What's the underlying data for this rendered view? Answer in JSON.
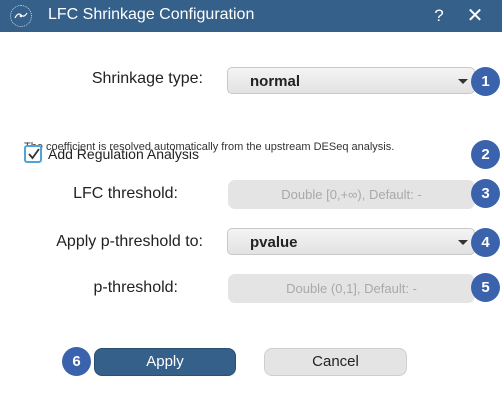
{
  "window": {
    "title": "LFC Shrinkage Configuration",
    "help_label": "?",
    "close_label": "✕",
    "app_icon": "app-logo-icon",
    "accent_color": "#34608a"
  },
  "form": {
    "shrinkage_type": {
      "label": "Shrinkage type:",
      "value": "normal"
    },
    "note": "The coefficient is resolved automatically from the upstream DESeq analysis.",
    "regulation": {
      "label": "Add Regulation Analysis",
      "checked": true
    },
    "lfc_threshold": {
      "label": "LFC threshold:",
      "placeholder": "Double [0,+∞), Default: -"
    },
    "apply_p_threshold": {
      "label": "Apply p-threshold to:",
      "value": "pvalue"
    },
    "p_threshold": {
      "label": "p-threshold:",
      "placeholder": "Double (0,1], Default: -"
    }
  },
  "buttons": {
    "apply": "Apply",
    "cancel": "Cancel"
  },
  "badges": [
    "1",
    "2",
    "3",
    "4",
    "5",
    "6"
  ],
  "badge_color": "#3b62ac"
}
